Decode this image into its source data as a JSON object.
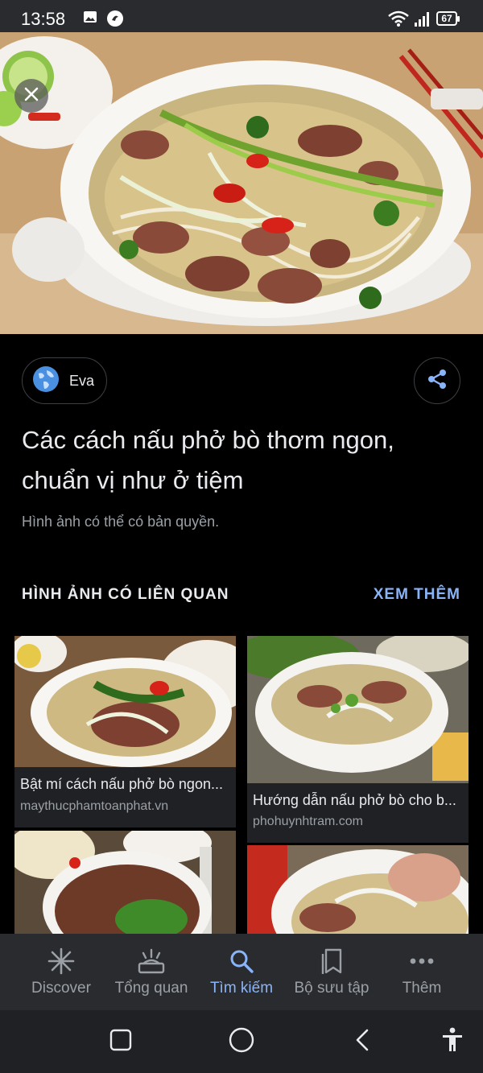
{
  "status_bar": {
    "time": "13:58",
    "battery": "67"
  },
  "hero": {
    "close_icon": "close-icon"
  },
  "source": {
    "name": "Eva",
    "icon": "globe-icon"
  },
  "share_icon": "share-icon",
  "title": "Các cách nấu phở bò thơm ngon, chuẩn vị như ở tiệm",
  "copyright_note": "Hình ảnh có thể có bản quyền.",
  "related": {
    "heading": "HÌNH ẢNH CÓ LIÊN QUAN",
    "see_more": "XEM THÊM",
    "items": [
      {
        "title": "Bật mí cách nấu phở bò ngon...",
        "domain": "maythucphamtoanphat.vn"
      },
      {
        "title": "Hướng dẫn nấu phở bò cho b...",
        "domain": "phohuynhtram.com"
      },
      {
        "title": "",
        "domain": ""
      },
      {
        "title": "",
        "domain": ""
      }
    ]
  },
  "bottom_nav": {
    "items": [
      {
        "label": "Discover",
        "icon": "asterisk-icon"
      },
      {
        "label": "Tổng quan",
        "icon": "snapshot-icon"
      },
      {
        "label": "Tìm kiếm",
        "icon": "search-icon"
      },
      {
        "label": "Bộ sưu tập",
        "icon": "collections-icon"
      },
      {
        "label": "Thêm",
        "icon": "more-icon"
      }
    ],
    "active": "Tìm kiếm"
  },
  "colors": {
    "accent": "#8ab4f8",
    "background": "#000000",
    "surface": "#202124"
  }
}
